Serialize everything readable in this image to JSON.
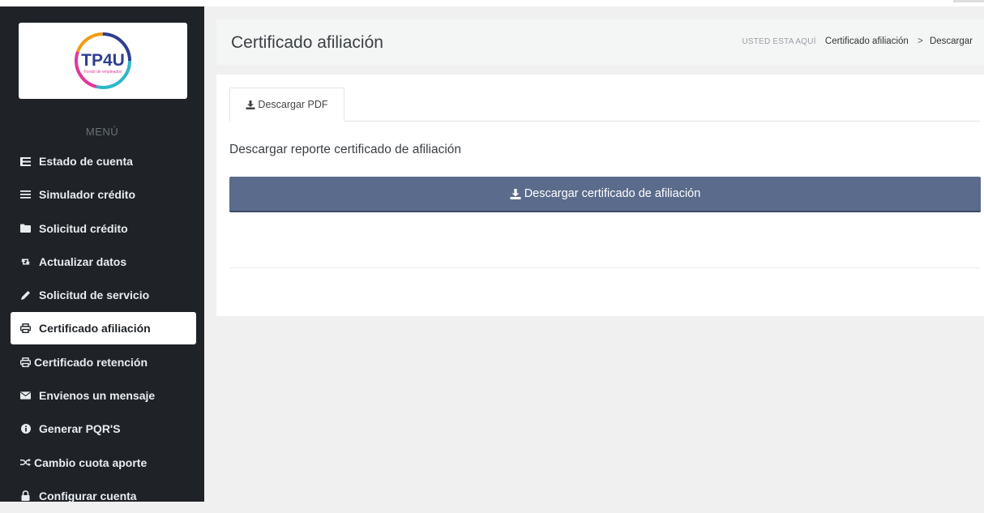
{
  "brand": {
    "logo_text": "TP4U",
    "logo_subtext": "Fondo de empleados",
    "colors": {
      "teal": "#2bb7c8",
      "pink": "#e0389a",
      "orange": "#f39c12",
      "blue": "#2f3e8f"
    }
  },
  "sidebar": {
    "menu_title": "MENÚ",
    "items": [
      {
        "label": "Estado de cuenta",
        "icon": "list-icon"
      },
      {
        "label": "Simulador crédito",
        "icon": "bars-icon"
      },
      {
        "label": "Solicitud crédito",
        "icon": "folder-icon"
      },
      {
        "label": "Actualizar datos",
        "icon": "retweet-icon"
      },
      {
        "label": "Solicitud de servicio",
        "icon": "pencil-icon"
      },
      {
        "label": "Certificado afiliación",
        "icon": "print-icon",
        "active": true
      },
      {
        "label": "Certificado retención",
        "icon": "print-icon"
      },
      {
        "label": "Envienos un mensaje",
        "icon": "envelope-icon"
      },
      {
        "label": "Generar PQR'S",
        "icon": "info-circle-icon"
      },
      {
        "label": "Cambio cuota aporte",
        "icon": "random-icon"
      },
      {
        "label": "Configurar cuenta",
        "icon": "lock-icon"
      }
    ]
  },
  "header": {
    "title": "Certificado afiliación",
    "breadcrumb": {
      "here": "USTED ESTA AQUÍ",
      "items": [
        "Certificado afiliación",
        "Descargar"
      ],
      "separator": ">"
    }
  },
  "main": {
    "tab_label": "Descargar PDF",
    "description": "Descargar reporte certificado de afiliación",
    "download_button": "Descargar certificado de afiliación",
    "button_color": "#5a6b8c"
  }
}
